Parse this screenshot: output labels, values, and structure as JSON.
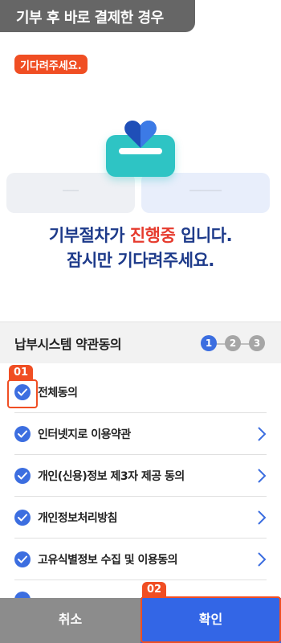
{
  "header": {
    "tab_title": "기부 후 바로 결제한 경우"
  },
  "wait_badge": "기다려주세요.",
  "loading": {
    "icon": "donation-box-heart-icon",
    "line1_part1": "기부절차가 ",
    "line1_highlight": "진행중",
    "line1_part2": " 입니다.",
    "line2": "잠시만 기다려주세요.",
    "colors": {
      "text": "#1d3a8a",
      "highlight": "#e63b2e",
      "box": "#2ec4c4"
    }
  },
  "agreement": {
    "title": "납부시스템 약관동의",
    "steps": [
      "1",
      "2",
      "3"
    ],
    "active_step": 1,
    "items": [
      {
        "label": "전체동의",
        "checked": true,
        "has_chevron": false
      },
      {
        "label": "인터넷지로 이용약관",
        "checked": true,
        "has_chevron": true
      },
      {
        "label": "개인(신용)정보 제3자 제공 동의",
        "checked": true,
        "has_chevron": true
      },
      {
        "label": "개인정보처리방침",
        "checked": true,
        "has_chevron": true
      },
      {
        "label": "고유식별정보 수집 및 이용동의",
        "checked": true,
        "has_chevron": true
      }
    ]
  },
  "callouts": {
    "first": "01",
    "second": "02"
  },
  "buttons": {
    "cancel": "취소",
    "confirm": "확인"
  },
  "colors": {
    "accent": "#3366e6",
    "callout": "#f04e23",
    "cancel_bg": "#8c8c8c"
  }
}
